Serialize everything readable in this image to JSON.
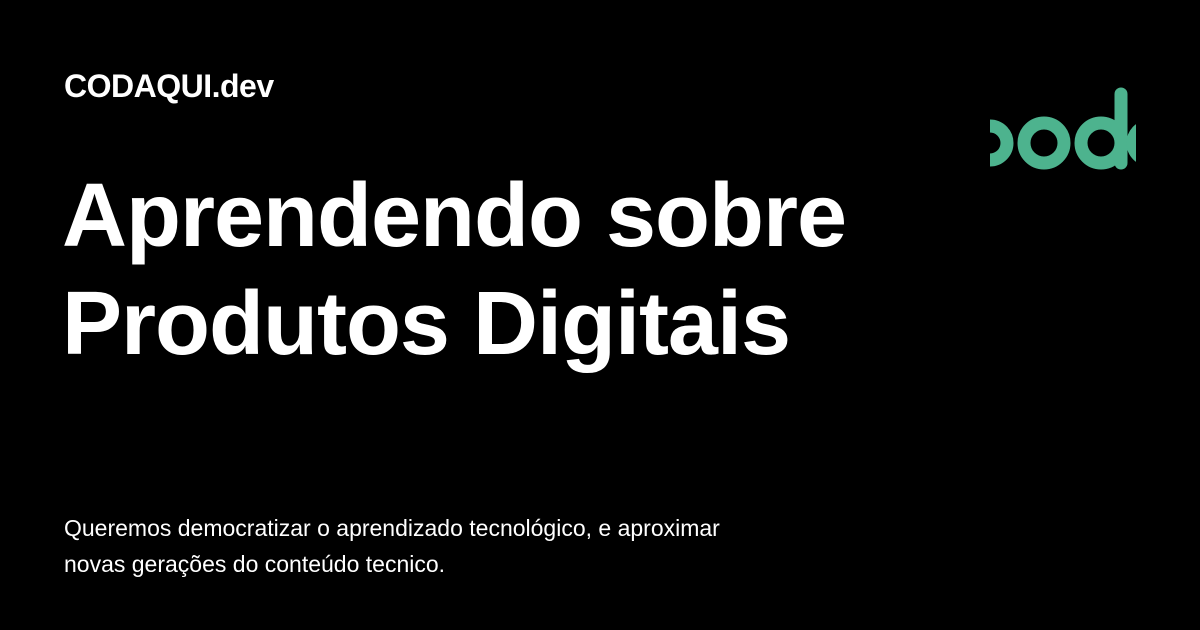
{
  "card": {
    "site_name": "CODAQUI.dev",
    "headline": {
      "line1": "Aprendendo sobre",
      "line2": "Produtos Digitais"
    },
    "description": {
      "line1": "Queremos democratizar o aprendizado tecnológico, e aproximar",
      "line2": "novas gerações do conteúdo tecnico."
    },
    "logo": {
      "icon": "codaqui-logo-icon",
      "color": "#4DB38E"
    },
    "colors": {
      "background": "#000000",
      "text": "#FFFFFF",
      "accent": "#4DB38E"
    }
  }
}
